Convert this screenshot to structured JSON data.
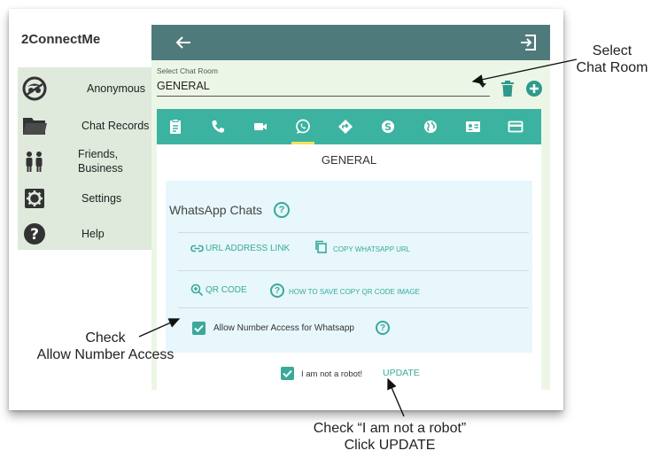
{
  "app": {
    "name": "2ConnectMe"
  },
  "sidebar": {
    "items": [
      {
        "label": "Anonymous",
        "icon": "incognito-icon"
      },
      {
        "label": "Chat Records",
        "icon": "folder-icon"
      },
      {
        "label": "Friends,\nBusiness",
        "icon": "people-icon"
      },
      {
        "label": "Settings",
        "icon": "gear-icon"
      },
      {
        "label": "Help",
        "icon": "help-circle-icon"
      }
    ]
  },
  "chat_room": {
    "label": "Select Chat Room",
    "selected": "GENERAL"
  },
  "tabs": [
    {
      "icon": "clipboard-icon"
    },
    {
      "icon": "phone-icon"
    },
    {
      "icon": "video-icon"
    },
    {
      "icon": "whatsapp-icon",
      "active": true
    },
    {
      "icon": "directions-icon"
    },
    {
      "icon": "skype-icon"
    },
    {
      "icon": "globe-icon"
    },
    {
      "icon": "contact-card-icon"
    },
    {
      "icon": "card-icon"
    }
  ],
  "card": {
    "title": "GENERAL",
    "section_title": "WhatsApp Chats",
    "help_glyph": "?",
    "url_link": "URL ADDRESS LINK",
    "copy_url": "COPY WHATSAPP URL",
    "qr_code": "QR CODE",
    "how_to_save": "HOW TO SAVE COPY QR CODE IMAGE",
    "allow_number_access": "Allow Number Access for Whatsapp",
    "allow_number_access_checked": true,
    "not_robot": "I am not a robot!",
    "not_robot_checked": true,
    "update": "UPDATE"
  },
  "annotations": {
    "select_room": "Select\nChat Room",
    "check_allow": "Check\nAllow Number Access",
    "check_robot": "Check “I am not a  robot”\nClick UPDATE"
  },
  "colors": {
    "topbar": "#4f7a7b",
    "iconbar": "#3cb3a1",
    "accent": "#3aa99a",
    "menu_bg": "#dfe9dc",
    "panel_bg": "#ecf6e7",
    "inner_bg": "#e7f7fb",
    "danger": "#2e9a8c",
    "tab_indicator": "#f4e35c"
  }
}
